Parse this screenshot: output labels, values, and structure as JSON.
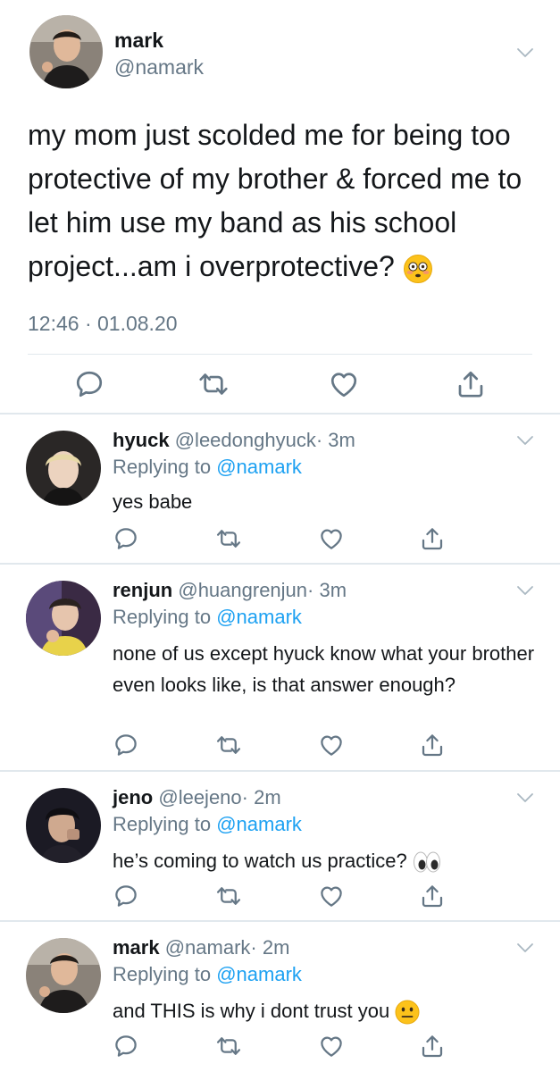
{
  "main_tweet": {
    "name": "mark",
    "handle": "@namark",
    "body": "my mom just scolded me for being too protective of my brother & forced me to let him use my band as his school project...am i overprotective?",
    "timestamp": "12:46 · 01.08.20"
  },
  "replies": [
    {
      "name": "hyuck",
      "handle": "@leedonghyuck",
      "time": "· 3m",
      "replying_prefix": "Replying to",
      "replying_to": "@namark",
      "text": "yes babe"
    },
    {
      "name": "renjun",
      "handle": "@huangrenjun",
      "time": "· 3m",
      "replying_prefix": "Replying to",
      "replying_to": "@namark",
      "text": "none of us except hyuck know what your brother even looks like, is that answer enough?"
    },
    {
      "name": "jeno",
      "handle": "@leejeno",
      "time": "· 2m",
      "replying_prefix": "Replying to",
      "replying_to": "@namark",
      "text": "he’s coming to watch us practice?"
    },
    {
      "name": "mark",
      "handle": "@namark",
      "time": "· 2m",
      "replying_prefix": "Replying to",
      "replying_to": "@namark",
      "text": "and THIS is why i dont trust you"
    }
  ],
  "icons": {
    "action_icons": [
      "comment-icon",
      "retweet-icon",
      "like-icon",
      "share-icon"
    ],
    "emoji": [
      "flushed-face-emoji",
      "eyes-emoji",
      "grimacing-face-emoji"
    ],
    "colors": {
      "link": "#1da1f2",
      "muted": "#657786",
      "divider": "#e1e8ed"
    }
  }
}
